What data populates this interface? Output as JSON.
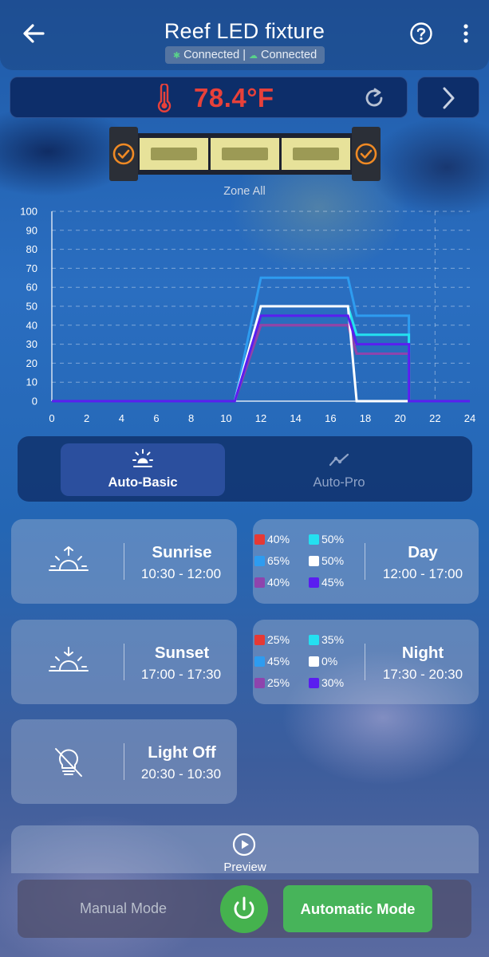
{
  "header": {
    "title": "Reef LED fixture",
    "status_bluetooth": "Connected",
    "status_separator": "|",
    "status_cloud": "Connected"
  },
  "temperature": {
    "value": "78.4°F"
  },
  "fixture": {
    "zone_label": "Zone All"
  },
  "chart_data": {
    "type": "line",
    "x_ticks": [
      "0",
      "2",
      "4",
      "6",
      "8",
      "10",
      "12",
      "14",
      "16",
      "18",
      "20",
      "22",
      "24"
    ],
    "y_ticks": [
      "0",
      "10",
      "20",
      "30",
      "40",
      "50",
      "60",
      "70",
      "80",
      "90",
      "100"
    ],
    "xlim": [
      0,
      24
    ],
    "ylim": [
      0,
      100
    ],
    "grid": true,
    "series": [
      {
        "color": "#e53935",
        "points": [
          [
            0,
            0
          ],
          [
            10.5,
            0
          ],
          [
            12,
            40
          ],
          [
            17,
            40
          ],
          [
            17.5,
            25
          ],
          [
            20.5,
            25
          ],
          [
            20.5,
            0
          ],
          [
            24,
            0
          ]
        ]
      },
      {
        "color": "#2e9cf0",
        "points": [
          [
            0,
            0
          ],
          [
            10.5,
            0
          ],
          [
            12,
            65
          ],
          [
            17,
            65
          ],
          [
            17.5,
            45
          ],
          [
            20.5,
            45
          ],
          [
            20.5,
            0
          ],
          [
            24,
            0
          ]
        ]
      },
      {
        "color": "#8e44ad",
        "points": [
          [
            0,
            0
          ],
          [
            10.5,
            0
          ],
          [
            12,
            40
          ],
          [
            17,
            40
          ],
          [
            17.5,
            25
          ],
          [
            20.5,
            25
          ],
          [
            20.5,
            0
          ],
          [
            24,
            0
          ]
        ]
      },
      {
        "color": "#24e0f0",
        "points": [
          [
            0,
            0
          ],
          [
            10.5,
            0
          ],
          [
            12,
            50
          ],
          [
            17,
            50
          ],
          [
            17.5,
            35
          ],
          [
            20.5,
            35
          ],
          [
            20.5,
            0
          ],
          [
            24,
            0
          ]
        ]
      },
      {
        "color": "#ffffff",
        "points": [
          [
            0,
            0
          ],
          [
            10.5,
            0
          ],
          [
            12,
            50
          ],
          [
            17,
            50
          ],
          [
            17.5,
            0
          ],
          [
            24,
            0
          ]
        ]
      },
      {
        "color": "#5a1ef0",
        "points": [
          [
            0,
            0
          ],
          [
            10.5,
            0
          ],
          [
            12,
            45
          ],
          [
            17,
            45
          ],
          [
            17.5,
            30
          ],
          [
            20.5,
            30
          ],
          [
            20.5,
            0
          ],
          [
            24,
            0
          ]
        ]
      }
    ]
  },
  "tabs": [
    {
      "label": "Auto-Basic",
      "active": true
    },
    {
      "label": "Auto-Pro",
      "active": false
    }
  ],
  "cards": {
    "sunrise": {
      "title": "Sunrise",
      "time": "10:30 - 12:00"
    },
    "day": {
      "title": "Day",
      "time": "12:00 - 17:00",
      "channels": [
        {
          "color": "#e53935",
          "pct": "40%"
        },
        {
          "color": "#24e0f0",
          "pct": "50%"
        },
        {
          "color": "#2e9cf0",
          "pct": "65%"
        },
        {
          "color": "#ffffff",
          "pct": "50%"
        },
        {
          "color": "#8e44ad",
          "pct": "40%"
        },
        {
          "color": "#5a1ef0",
          "pct": "45%"
        }
      ]
    },
    "sunset": {
      "title": "Sunset",
      "time": "17:00 - 17:30"
    },
    "night": {
      "title": "Night",
      "time": "17:30 - 20:30",
      "channels": [
        {
          "color": "#e53935",
          "pct": "25%"
        },
        {
          "color": "#24e0f0",
          "pct": "35%"
        },
        {
          "color": "#2e9cf0",
          "pct": "45%"
        },
        {
          "color": "#ffffff",
          "pct": "0%"
        },
        {
          "color": "#8e44ad",
          "pct": "25%"
        },
        {
          "color": "#5a1ef0",
          "pct": "30%"
        }
      ]
    },
    "light_off": {
      "title": "Light Off",
      "time": "20:30 - 10:30"
    }
  },
  "preview": {
    "label": "Preview"
  },
  "mode_bar": {
    "manual_label": "Manual Mode",
    "auto_label": "Automatic Mode"
  },
  "colors": {
    "accent_red": "#e8413a",
    "accent_green": "#47b45a",
    "fixture_check": "#f08a24"
  }
}
